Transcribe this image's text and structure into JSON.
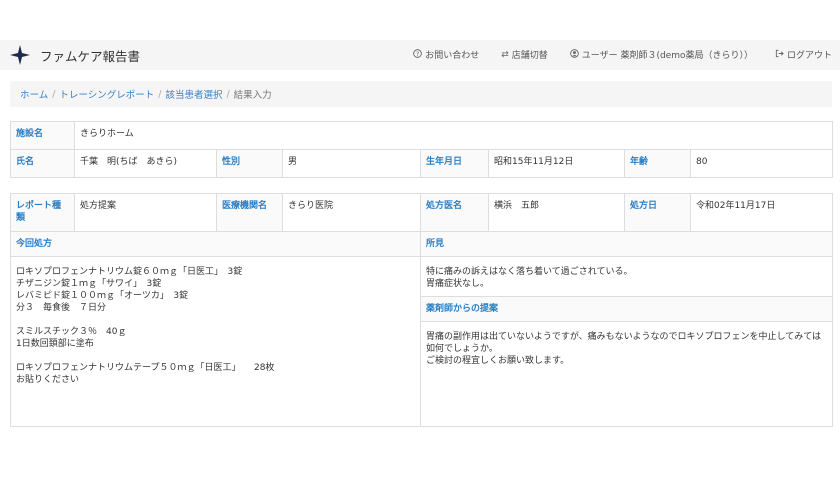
{
  "header": {
    "app_title": "ファムケア報告書",
    "brand_icon": "four-point-star-icon",
    "links": [
      {
        "icon": "question-circle-icon",
        "label": "お問い合わせ"
      },
      {
        "icon": "swap-arrows-icon",
        "label": "店舗切替"
      },
      {
        "icon": "user-circle-icon",
        "label": "ユーザー 薬剤師３(demo薬局（きらり））"
      },
      {
        "icon": "logout-icon",
        "label": "ログアウト"
      }
    ]
  },
  "breadcrumb": {
    "items": [
      "ホーム",
      "トレーシングレポート",
      "該当患者選択"
    ],
    "current": "結果入力"
  },
  "patient": {
    "facility_label": "施設名",
    "facility_value": "きらりホーム",
    "name_label": "氏名",
    "name_value": "千葉　明(ちば　あきら)",
    "sex_label": "性別",
    "sex_value": "男",
    "dob_label": "生年月日",
    "dob_value": "昭和15年11月12日",
    "age_label": "年齢",
    "age_value": "80"
  },
  "report": {
    "type_label": "レポート種類",
    "type_value": "処方提案",
    "institution_label": "医療機関名",
    "institution_value": "きらり医院",
    "doctor_label": "処方医名",
    "doctor_value": "横浜　五郎",
    "date_label": "処方日",
    "date_value": "令和02年11月17日"
  },
  "prescription": {
    "title": "今回処方",
    "body": "ロキソプロフェンナトリウム錠６０ｍｇ「日医工」　3錠\nチザニジン錠１ｍｇ「サワイ」　3錠\nレバミピド錠１００ｍｇ「オーツカ」　3錠\n分３　毎食後　７日分\n\nスミルスチック３％　40ｇ\n1日数回頚部に塗布\n\nロキソプロフェンナトリウムテープ５０ｍｇ「日医工」　　28枚\nお貼りください"
  },
  "findings": {
    "title": "所見",
    "body": "特に痛みの訴えはなく落ち着いて過ごされている。\n胃痛症状なし。"
  },
  "proposal": {
    "title": "薬剤師からの提案",
    "body": "胃痛の副作用は出ていないようですが、痛みもないようなのでロキソプロフェンを中止してみては如何でしょうか。\nご検討の程宜しくお願い致します。"
  },
  "colors": {
    "label_blue": "#2a7ec4",
    "link_blue": "#3a7fc2",
    "navbar_bg": "#f5f5f5",
    "brand_star": "#1f2a4d"
  }
}
